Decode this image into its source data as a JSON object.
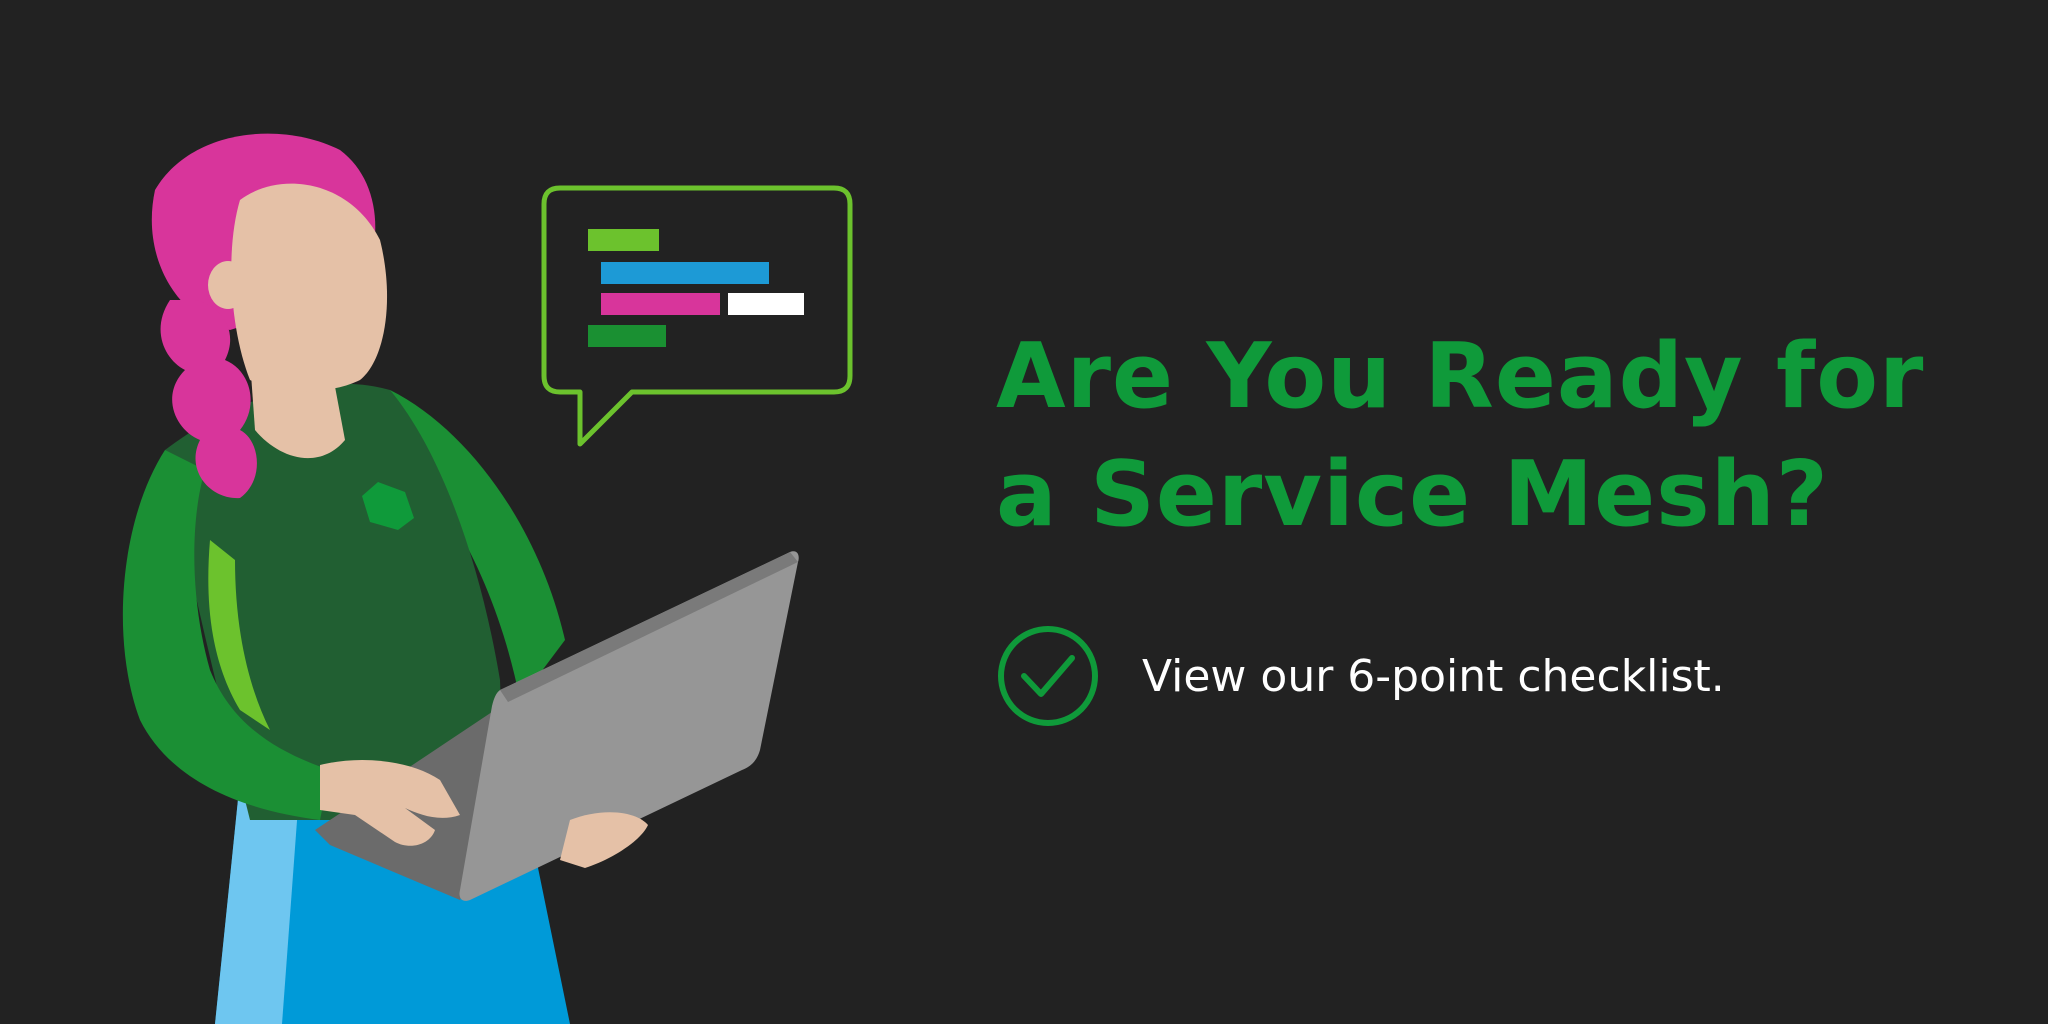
{
  "headline": {
    "line1": "Are You Ready for",
    "line2": "a Service Mesh?"
  },
  "cta": {
    "text": "View our 6-point checklist.",
    "icon": "check-circle-icon"
  },
  "colors": {
    "background": "#222222",
    "accent_green": "#0f9a3a",
    "lime": "#6cc22d",
    "blue": "#1d9ad6",
    "magenta": "#d8359b",
    "text_white": "#ffffff"
  },
  "illustration": {
    "subject": "person-with-laptop",
    "speech_bubble_icon": "code-chat-bubble-icon"
  }
}
